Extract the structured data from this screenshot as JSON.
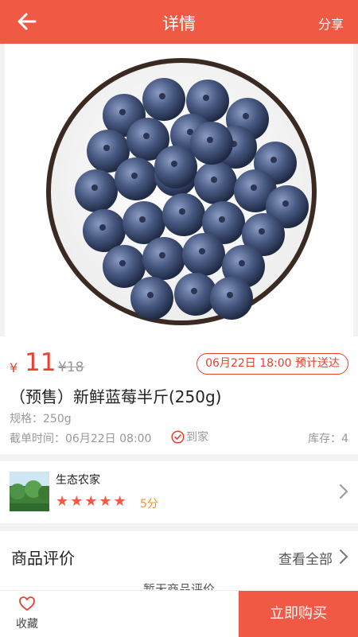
{
  "header": {
    "title": "详情",
    "share_label": "分享",
    "back_icon": "arrow-left-icon"
  },
  "product": {
    "currency_symbol": "¥",
    "price": "11",
    "original_price": "¥18",
    "delivery_badge": "06月22日 18:00 预计送达",
    "name": "（预售）新鲜蓝莓半斤(250g)",
    "spec": "规格：250g",
    "cutoff_time": "截单时间：06月22日 08:00",
    "delivery_mode": "到家",
    "stock": "库存：4"
  },
  "store": {
    "name": "生态农家",
    "stars": "★★★★★",
    "rating": 5,
    "rating_text": "5分"
  },
  "reviews": {
    "title": "商品评价",
    "see_all": "查看全部",
    "empty_text": "暂无商品评价"
  },
  "bottom_bar": {
    "favorite_label": "收藏",
    "buy_label": "立即购买"
  },
  "colors": {
    "brand": "#f05a44",
    "price": "#e8402f",
    "rating_text": "#f0912c"
  }
}
